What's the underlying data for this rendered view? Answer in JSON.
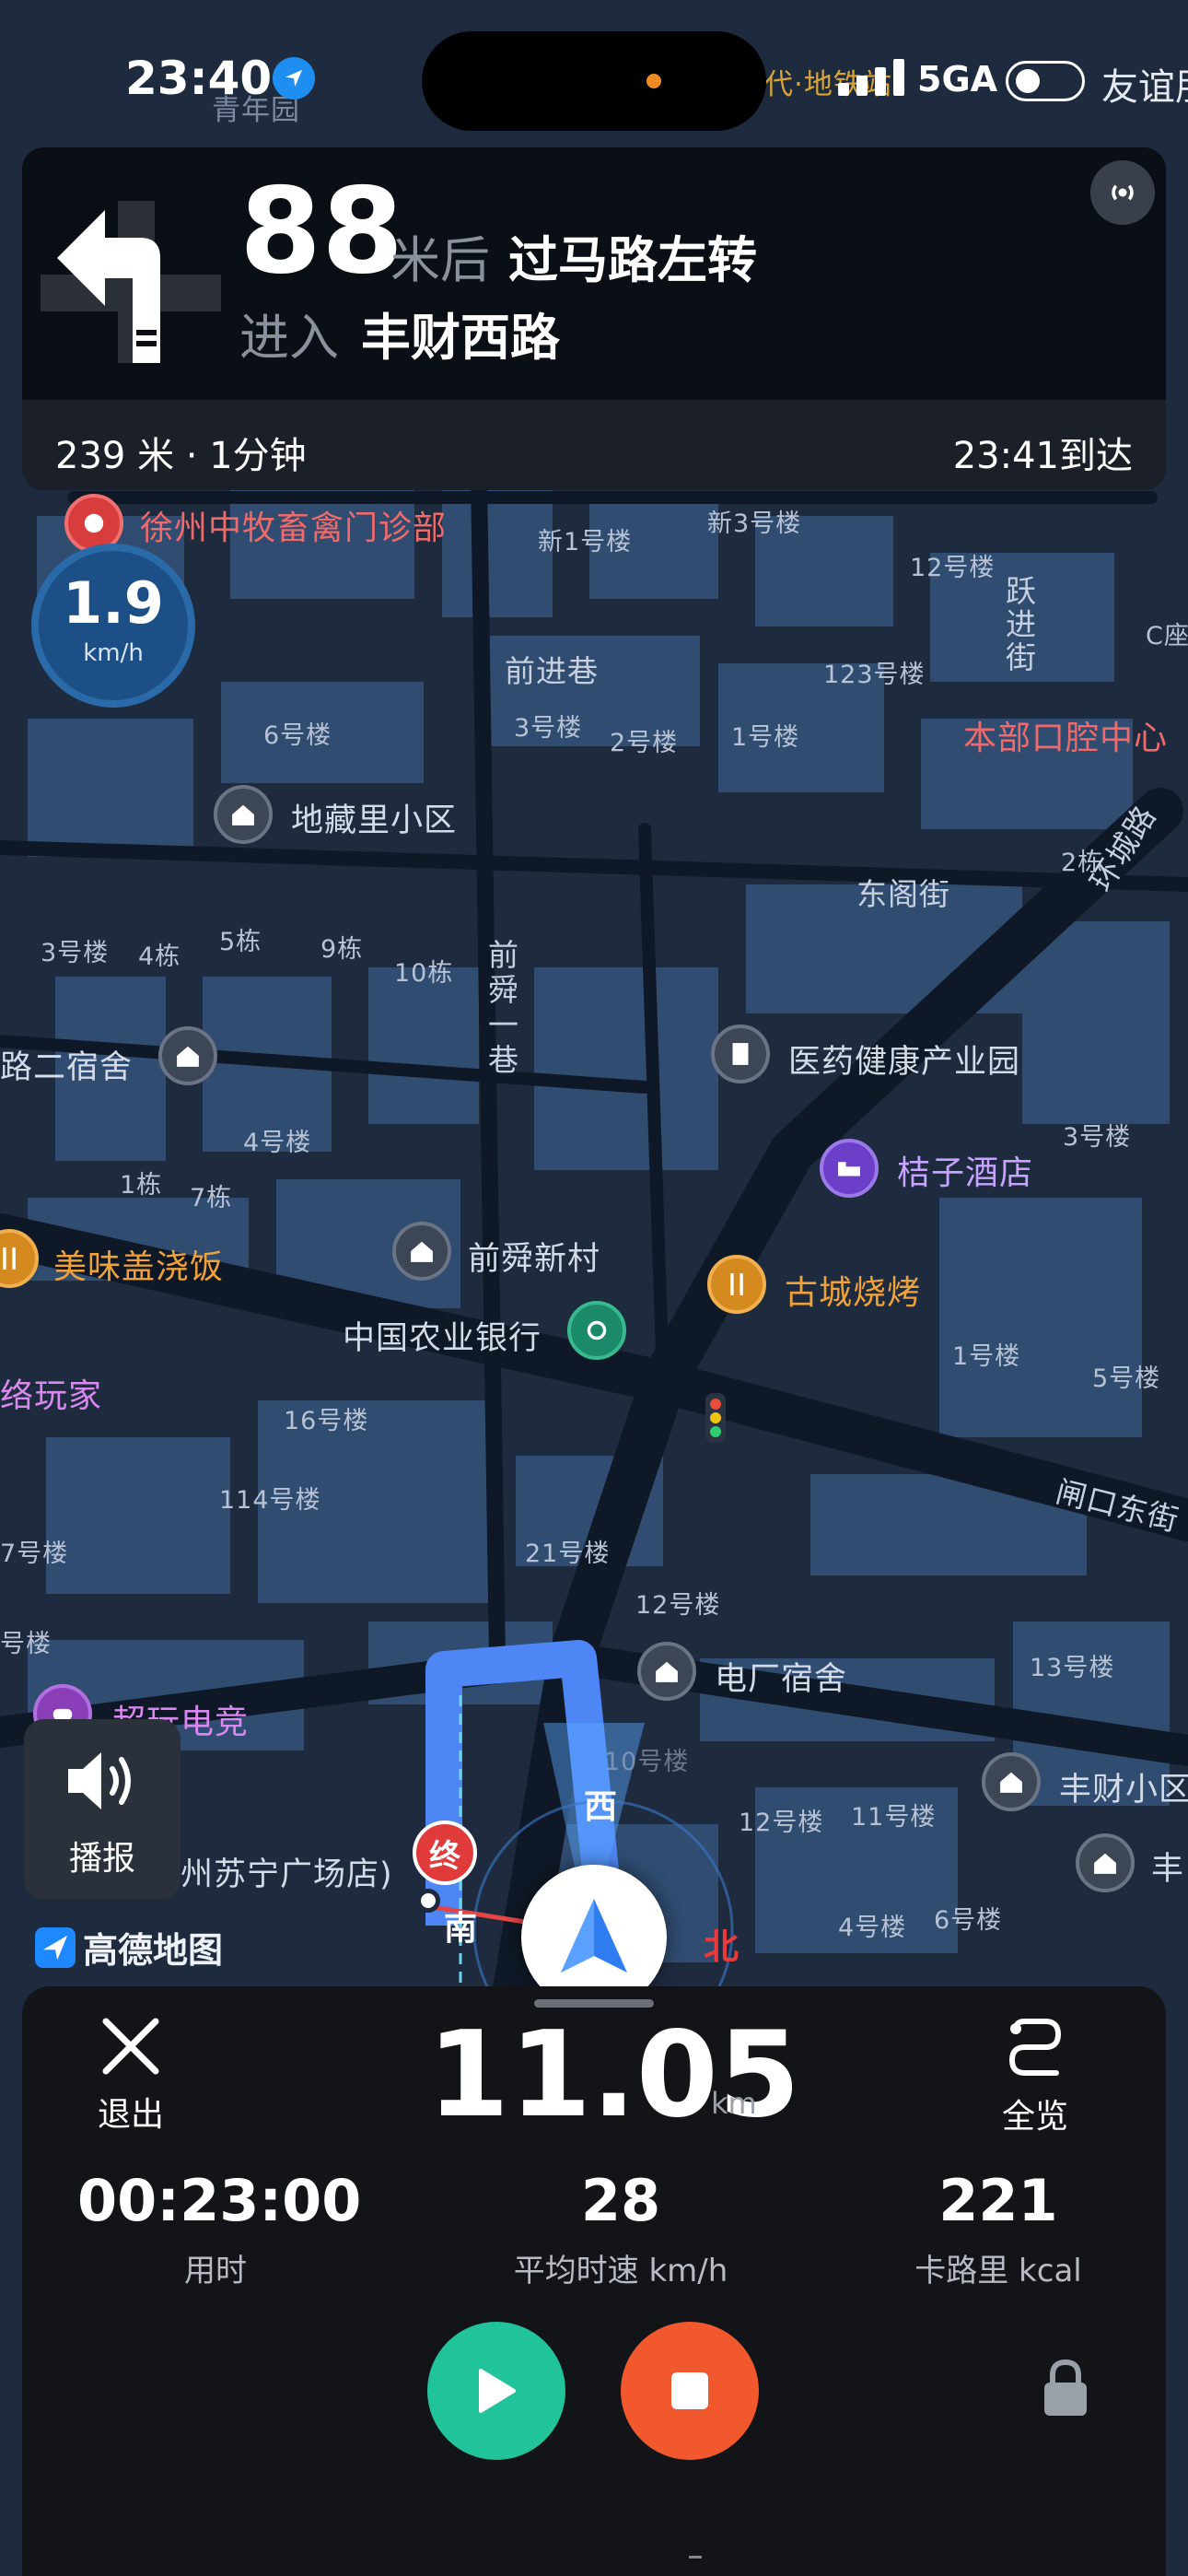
{
  "status_bar": {
    "time": "23:40",
    "network": "5GA",
    "carrier": "友谊朋"
  },
  "navigation": {
    "distance": "88",
    "distance_suffix": "米后",
    "action": "过马路左转",
    "enter_label": "进入",
    "road": "丰财西路",
    "remaining": "239 米 · 1分钟",
    "arrival": "23:41到达"
  },
  "speed": {
    "value": "1.9",
    "unit": "km/h"
  },
  "map": {
    "labels": {
      "top_poi": "青年园",
      "top_road": "代·地铁站",
      "clinic": "徐州中牧畜禽门诊部",
      "b_new1": "新1号楼",
      "b_new3": "新3号楼",
      "b_12": "12号楼",
      "yue_jin_jie": "跃进街",
      "c_bld": "C座",
      "qian_jin_xiang": "前进巷",
      "b_123": "123号楼",
      "dental": "本部口腔中心",
      "b_6": "6号楼",
      "b_3": "3号楼",
      "b_2": "2号楼",
      "b_1": "1号楼",
      "di_zang_li": "地藏里小区",
      "b_2dong": "2栋",
      "huan_cheng_lu": "环城路",
      "dong_ge_jie": "东阁街",
      "b_3lou": "3号楼",
      "b_4dong": "4栋",
      "b_5dong": "5栋",
      "b_9dong": "9栋",
      "b_10dong": "10栋",
      "qian_shun_yi_xiang": "前舜一巷",
      "er_su_she": "路二宿舍",
      "pharma_park": "医药健康产业园",
      "b_4lou": "4号楼",
      "b_3lou_r": "3号楼",
      "hotel": "桔子酒店",
      "b_1dong": "1栋",
      "b_7dong": "7栋",
      "qian_shun_xin_cun": "前舜新村",
      "rice_shop": "美味盖浇饭",
      "bbq": "古城烧烤",
      "abc_bank": "中国农业银行",
      "b_1lou": "1号楼",
      "b_5lou": "5号楼",
      "gamer": "络玩家",
      "b_16": "16号楼",
      "zha_kou_dong_jie": "闸口东街",
      "b_114": "114号楼",
      "b_7left": "7号楼",
      "b_21": "21号楼",
      "b_12b": "12号楼",
      "b_left": "号楼",
      "power_dorm": "电厂宿舍",
      "b_13": "13号楼",
      "esports": "超玩电竞",
      "b_10": "10号楼",
      "west": "西",
      "feng_cai_xiao_qu": "丰财小区",
      "b_12c": "12号楼",
      "b_11": "11号楼",
      "suning": "州苏宁广场店)",
      "end_marker": "终",
      "south": "南",
      "north": "北",
      "b_4lou_b": "4号楼",
      "b_6lou": "6号楼",
      "feng_right": "丰"
    }
  },
  "report_button": {
    "label": "播报"
  },
  "brand": "高德地图",
  "bottom_panel": {
    "exit_label": "退出",
    "overview_label": "全览",
    "total_distance": "11.05",
    "total_distance_unit": "km",
    "stats": [
      {
        "value": "00:23:00",
        "label": "用时"
      },
      {
        "value": "28",
        "label": "平均时速 km/h"
      },
      {
        "value": "221",
        "label": "卡路里 kcal"
      }
    ]
  },
  "colors": {
    "route": "#4f86f5",
    "play": "#21c39a",
    "stop": "#f1582d",
    "speed_badge": "#1b4f86"
  }
}
